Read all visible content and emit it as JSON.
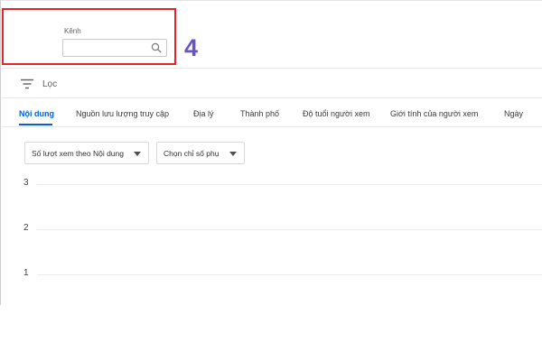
{
  "channel": {
    "label": "Kênh",
    "value": "",
    "placeholder": ""
  },
  "step_number": "4",
  "filter": {
    "label": "Lọc"
  },
  "tabs": [
    {
      "label": "Nội dung",
      "active": true
    },
    {
      "label": "Nguồn lưu lượng truy cập",
      "active": false
    },
    {
      "label": "Địa lý",
      "active": false
    },
    {
      "label": "Thành phố",
      "active": false
    },
    {
      "label": "Độ tuổi người xem",
      "active": false
    },
    {
      "label": "Giới tính của người xem",
      "active": false
    },
    {
      "label": "Ngày",
      "active": false
    }
  ],
  "dropdowns": {
    "primary_metric": "Số lượt xem theo Nội dung",
    "secondary_metric": "Chọn chỉ số phụ"
  },
  "chart": {
    "y_ticks": [
      "3",
      "2",
      "1"
    ]
  },
  "colors": {
    "accent": "#065fd4",
    "highlight": "#e0262b",
    "step_number": "#6654c9"
  },
  "icons": {
    "search": "search-icon",
    "filter": "filter-icon",
    "dropdown": "caret-down-icon"
  }
}
